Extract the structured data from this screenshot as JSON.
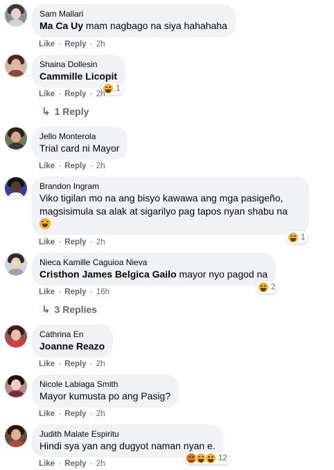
{
  "actions": {
    "like": "Like",
    "reply": "Reply",
    "sep": "·"
  },
  "comments": [
    {
      "author": "Sam Mallari",
      "tag": "Ma Ca Uy",
      "text": " mam nagbago na siya hahahaha",
      "time": "2h",
      "colors": [
        "#8b8f99",
        "#e8d3c4",
        "#3a3a3a",
        "#d0d3d8"
      ]
    },
    {
      "author": "Shaina Dollesin",
      "tag": "Cammille Licopit",
      "text": "",
      "time": "2h",
      "reaction_count": "1",
      "colors": [
        "#c9b9a8",
        "#e2b8a0",
        "#4a2a1e",
        "#8a4a3a"
      ]
    },
    {
      "author": "Jello Monterola",
      "tag": "",
      "text": "Trial card ni Mayor",
      "time": "2h",
      "colors": [
        "#6f7a5e",
        "#d9a88a",
        "#2b2117",
        "#3b3b3b"
      ]
    },
    {
      "author": "Brandon Ingram",
      "tag": "",
      "text_lines": [
        "Viko tigilan mo na ang bisyo kawawa ang mga pasigeño,",
        "magsisimula sa alak at sigarilyo pag tapos nyan shabu na"
      ],
      "time": "2h",
      "reaction_count": "1",
      "colors": [
        "#3e3aa0",
        "#5a3a28",
        "#141414",
        "#f2f2f2"
      ]
    },
    {
      "author": "Nieca Kamille Caguioa Nieva",
      "tag": "Cristhon James Belgica Gailo",
      "text": " mayor nyo pagod na",
      "time": "16h",
      "reaction_count": "2",
      "colors": [
        "#cfd6dd",
        "#f1d2bf",
        "#2f2a27",
        "#9aa3ad"
      ]
    },
    {
      "author": "Cathrina En",
      "tag": "Joanne Reazo",
      "text": "",
      "time": "2h",
      "colors": [
        "#a04f4f",
        "#e8c0a6",
        "#3a1f18",
        "#d44040"
      ]
    },
    {
      "author": "Nicole Labiaga Smith",
      "tag": "",
      "text": "Mayor kumusta po ang Pasig?",
      "time": "2h",
      "colors": [
        "#b78a8a",
        "#f0cfc0",
        "#1e1410",
        "#7a2a30"
      ]
    },
    {
      "author": "Judith Malate Espiritu",
      "tag": "",
      "text": "Hindi sya yan ang dugyot naman nyan e.",
      "time": "2h",
      "reaction_count": "12",
      "colors": [
        "#6b4a3d",
        "#e0b092",
        "#2a1812",
        "#b04a3a"
      ]
    }
  ],
  "reply_links": [
    {
      "label": "1 Reply"
    },
    {
      "label": "3 Replies"
    }
  ]
}
